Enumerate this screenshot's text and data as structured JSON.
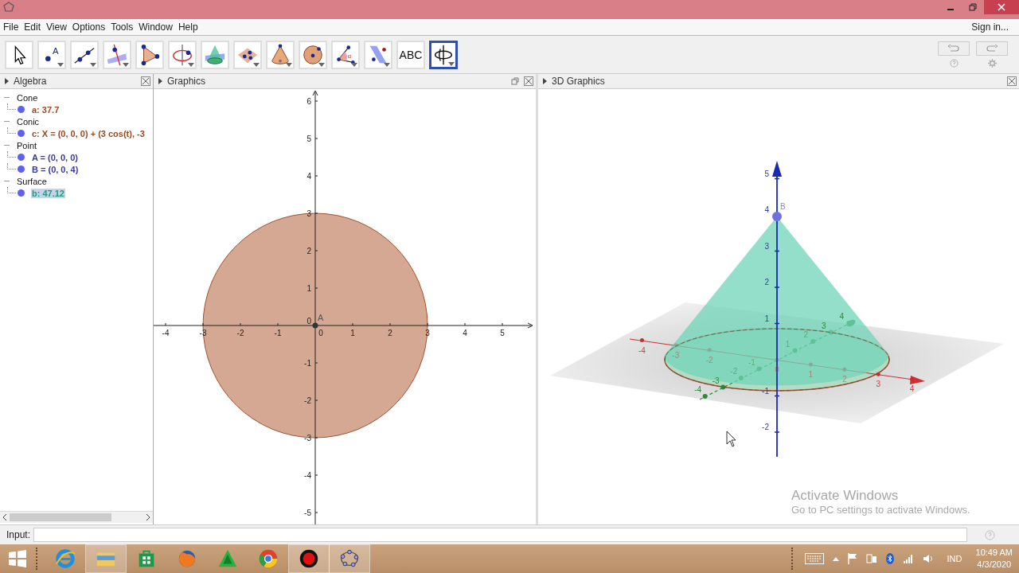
{
  "window": {
    "menu": [
      "File",
      "Edit",
      "View",
      "Options",
      "Tools",
      "Window",
      "Help"
    ],
    "sign_in": "Sign in..."
  },
  "toolbar": {
    "tools": [
      {
        "kind": "move",
        "menu": false,
        "selected": false
      },
      {
        "kind": "point",
        "glyph": "A",
        "menu": true,
        "selected": false
      },
      {
        "kind": "line",
        "menu": true,
        "selected": false
      },
      {
        "kind": "perpendicular",
        "menu": true,
        "selected": false
      },
      {
        "kind": "polygon",
        "menu": false,
        "selected": false
      },
      {
        "kind": "circle-axis",
        "menu": true,
        "selected": false
      },
      {
        "kind": "intersect",
        "menu": false,
        "selected": false
      },
      {
        "kind": "plane",
        "menu": true,
        "selected": false
      },
      {
        "kind": "cone",
        "menu": true,
        "selected": false
      },
      {
        "kind": "sphere",
        "menu": true,
        "selected": false
      },
      {
        "kind": "angle",
        "glyph": "α",
        "menu": true,
        "selected": false
      },
      {
        "kind": "reflect",
        "menu": true,
        "selected": false
      },
      {
        "kind": "text",
        "label": "ABC",
        "menu": false,
        "selected": false
      },
      {
        "kind": "rotate",
        "menu": true,
        "selected": true
      }
    ]
  },
  "algebra": {
    "title": "Algebra",
    "groups": [
      {
        "name": "Cone",
        "expanded": true,
        "children": [
          {
            "text": "a: 37.7",
            "color": "#9a4a1c",
            "selected": false
          }
        ]
      },
      {
        "name": "Conic",
        "expanded": true,
        "children": [
          {
            "text": "c: X = (0, 0, 0) + (3 cos(t), -3",
            "color": "#9a4a1c",
            "selected": false
          }
        ]
      },
      {
        "name": "Point",
        "expanded": true,
        "children": [
          {
            "text": "A = (0, 0, 0)",
            "color": "#3a3a9a",
            "selected": false
          },
          {
            "text": "B = (0, 0, 4)",
            "color": "#3a3a9a",
            "selected": false
          }
        ]
      },
      {
        "name": "Surface",
        "expanded": true,
        "children": [
          {
            "text": "b: 47.12",
            "color": "#239a7c",
            "selected": true
          }
        ]
      }
    ]
  },
  "graphics": {
    "title": "Graphics",
    "x_labels": [
      "-4",
      "-3",
      "-2",
      "-1",
      "0",
      "1",
      "2",
      "3",
      "4",
      "5"
    ],
    "y_labels": [
      "6",
      "5",
      "4",
      "3",
      "2",
      "1",
      "0",
      "-1",
      "-2",
      "-3",
      "-4",
      "-5"
    ],
    "point_label": "A"
  },
  "graphics3d": {
    "title": "3D Graphics",
    "z_labels": [
      "5",
      "4",
      "3",
      "2",
      "1",
      "-1",
      "-2"
    ],
    "x_labels": [
      "-4",
      "-3",
      "-2",
      "0",
      "1",
      "2",
      "3",
      "4"
    ],
    "y_labels": [
      "-4",
      "-3",
      "-2",
      "-1",
      "1",
      "2",
      "3",
      "4"
    ],
    "point_label": "B"
  },
  "input": {
    "label": "Input:"
  },
  "notice": {
    "title": "Activate Windows",
    "text": "Go to PC settings to activate Windows."
  },
  "taskbar": {
    "apps": [
      {
        "kind": "browser-e",
        "open": false
      },
      {
        "kind": "folder",
        "open": true
      },
      {
        "kind": "store",
        "open": false
      },
      {
        "kind": "fox",
        "open": false
      },
      {
        "kind": "triangle",
        "open": false
      },
      {
        "kind": "chrome",
        "open": false
      },
      {
        "kind": "record",
        "open": true
      },
      {
        "kind": "geogebra",
        "open": true
      }
    ],
    "language": "IND",
    "time": "10:49 AM",
    "date": "4/3/2020"
  }
}
